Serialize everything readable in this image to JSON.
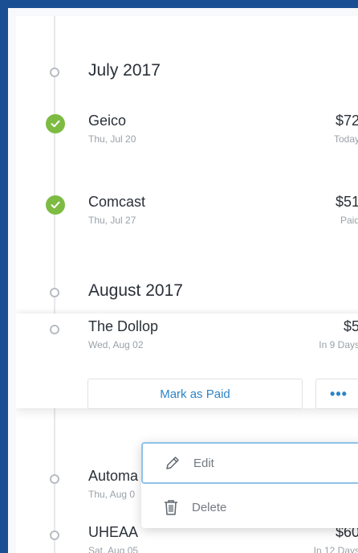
{
  "months": [
    {
      "title": "July 2017"
    },
    {
      "title": "August 2017"
    }
  ],
  "bills": [
    {
      "name": "Geico",
      "date": "Thu, Jul 20",
      "amount": "$72",
      "status": "Today",
      "paid": true
    },
    {
      "name": "Comcast",
      "date": "Thu, Jul 27",
      "amount": "$51",
      "status": "Paid",
      "paid": true
    },
    {
      "name": "The Dollop",
      "date": "Wed, Aug 02",
      "amount": "$5",
      "status": "In 9 Days",
      "paid": false
    },
    {
      "name": "Automa",
      "date": "Thu, Aug 0",
      "amount": "",
      "status": "",
      "paid": false
    },
    {
      "name": "UHEAA",
      "date": "Sat, Aug 05",
      "amount": "$60",
      "status": "In 12 Days",
      "paid": false
    }
  ],
  "actions": {
    "mark_paid_label": "Mark as Paid",
    "more_label": "•••"
  },
  "menu": {
    "edit_label": "Edit",
    "delete_label": "Delete"
  },
  "colors": {
    "frame_border": "#1a4f93",
    "paid_check": "#7dbb42",
    "accent": "#2d84c7",
    "menu_focus_border": "#8ec3ea"
  },
  "icons": {
    "paid": "check-circle-icon",
    "unpaid": "timeline-dot-icon",
    "edit": "pencil-icon",
    "delete": "trash-icon"
  }
}
